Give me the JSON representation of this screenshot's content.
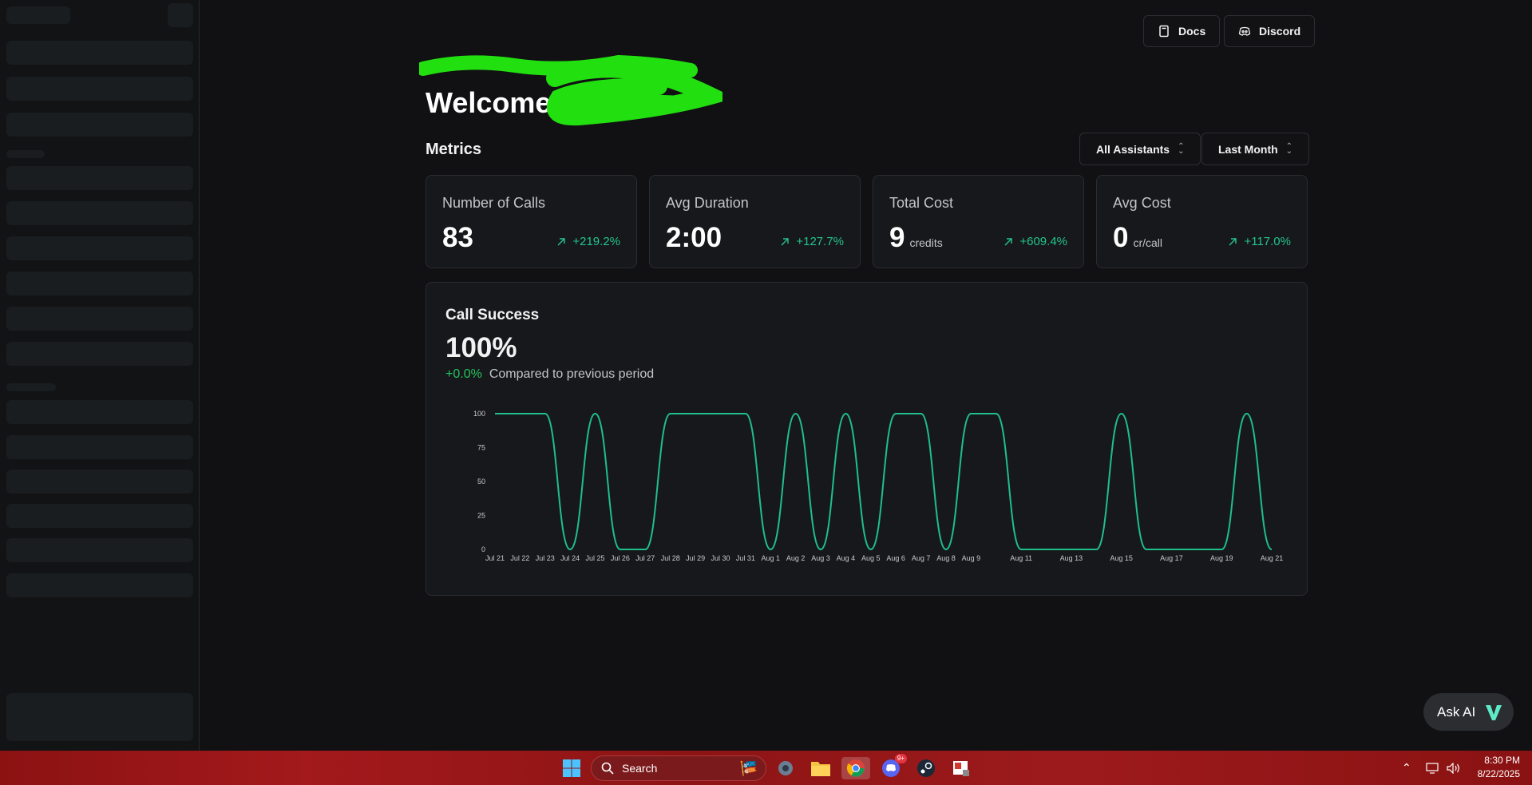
{
  "header": {
    "docs_label": "Docs",
    "discord_label": "Discord",
    "welcome_text": "Welcome"
  },
  "metrics": {
    "title": "Metrics",
    "assistant_filter": "All Assistants",
    "period_filter": "Last Month",
    "cards": [
      {
        "label": "Number of Calls",
        "value": "83",
        "unit": "",
        "delta": "+219.2%"
      },
      {
        "label": "Avg Duration",
        "value": "2:00",
        "unit": "",
        "delta": "+127.7%"
      },
      {
        "label": "Total Cost",
        "value": "9",
        "unit": "credits",
        "delta": "+609.4%"
      },
      {
        "label": "Avg Cost",
        "value": "0",
        "unit": "cr/call",
        "delta": "+117.0%"
      }
    ]
  },
  "call_success": {
    "title": "Call Success",
    "percent": "100%",
    "delta": "+0.0%",
    "compare_text": "Compared to previous period"
  },
  "chart_data": {
    "type": "area",
    "x_tick_labels": [
      "Jul 21",
      "Jul 22",
      "Jul 23",
      "Jul 24",
      "Jul 25",
      "Jul 26",
      "Jul 27",
      "Jul 28",
      "Jul 29",
      "Jul 30",
      "Jul 31",
      "Aug 1",
      "Aug 2",
      "Aug 3",
      "Aug 4",
      "Aug 5",
      "Aug 6",
      "Aug 7",
      "Aug 8",
      "Aug 9",
      "Aug 11",
      "Aug 13",
      "Aug 15",
      "Aug 17",
      "Aug 19",
      "Aug 21"
    ],
    "y_ticks": [
      0,
      25,
      50,
      75,
      100
    ],
    "ylim": [
      0,
      100
    ],
    "x": [
      "Jul 21",
      "Jul 22",
      "Jul 23",
      "Jul 24",
      "Jul 25",
      "Jul 26",
      "Jul 27",
      "Jul 28",
      "Jul 29",
      "Jul 30",
      "Jul 31",
      "Aug 1",
      "Aug 2",
      "Aug 3",
      "Aug 4",
      "Aug 5",
      "Aug 6",
      "Aug 7",
      "Aug 8",
      "Aug 9",
      "Aug 10",
      "Aug 11",
      "Aug 12",
      "Aug 13",
      "Aug 14",
      "Aug 15",
      "Aug 16",
      "Aug 17",
      "Aug 18",
      "Aug 19",
      "Aug 20",
      "Aug 21"
    ],
    "values": [
      100,
      100,
      100,
      0,
      100,
      0,
      0,
      100,
      100,
      100,
      100,
      0,
      100,
      0,
      100,
      0,
      100,
      100,
      0,
      100,
      100,
      0,
      0,
      0,
      0,
      100,
      0,
      0,
      0,
      0,
      100,
      0
    ],
    "line_color": "#1fbf8a"
  },
  "ask_ai": {
    "label": "Ask AI"
  },
  "taskbar": {
    "search_placeholder": "Search",
    "time": "8:30 PM",
    "date": "8/22/2025",
    "discord_badge": "9+"
  },
  "colors": {
    "accent_green": "#22c58b",
    "background": "#111113",
    "card": "#17181b"
  }
}
